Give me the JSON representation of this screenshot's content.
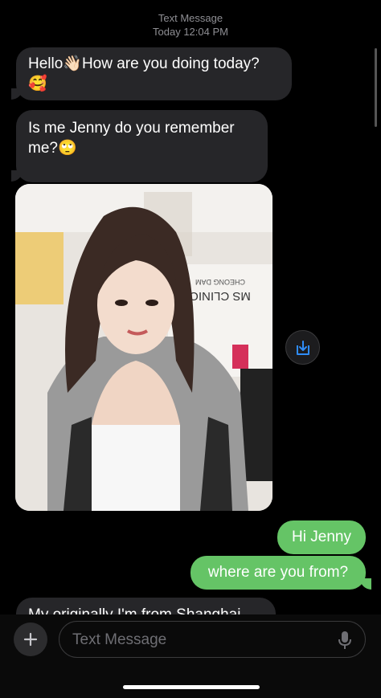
{
  "header": {
    "service": "Text Message",
    "timestamp": "Today 12:04 PM"
  },
  "messages": [
    {
      "direction": "incoming",
      "text": "Hello👋🏻How are you doing today?",
      "line2": "🥰"
    },
    {
      "direction": "incoming",
      "text": "Is me Jenny do you remember",
      "line2": "me?🙄"
    },
    {
      "direction": "incoming",
      "type": "photo",
      "sign_line1": "CHEONG DAM",
      "sign_line2": "MS CLINIC"
    },
    {
      "direction": "outgoing",
      "text": "Hi Jenny"
    },
    {
      "direction": "outgoing",
      "text": "where are you from?"
    },
    {
      "direction": "incoming",
      "text": "My originally I'm from Shanghai"
    }
  ],
  "composer": {
    "placeholder": "Text Message",
    "add_icon": "plus-icon",
    "mic_icon": "microphone-icon"
  },
  "colors": {
    "incoming": "#262629",
    "outgoing": "#65c466",
    "background": "#000000"
  }
}
